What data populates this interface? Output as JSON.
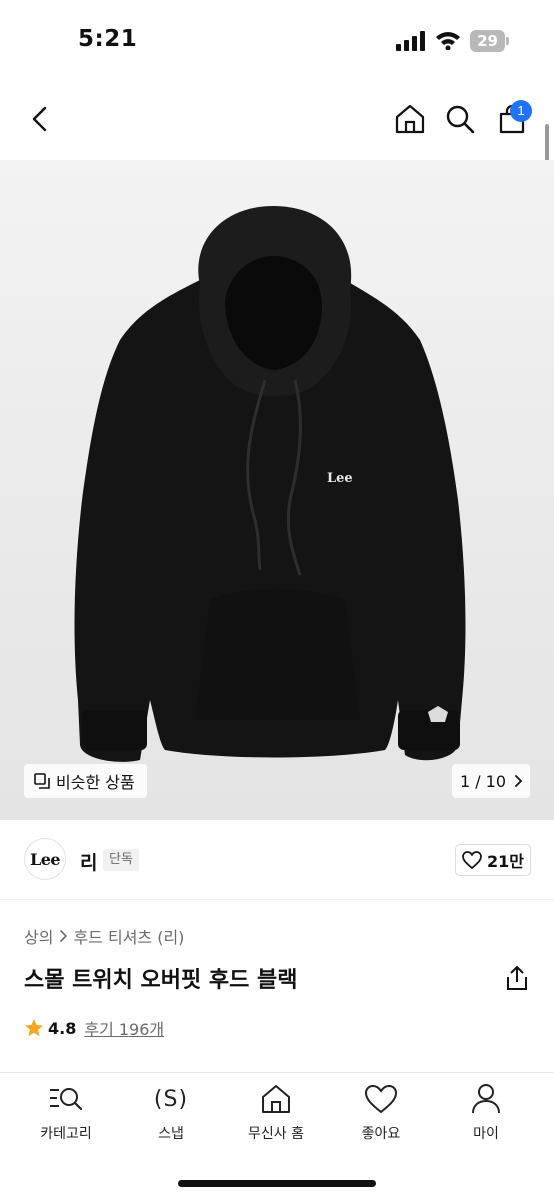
{
  "status_bar": {
    "time": "5:21",
    "battery": "29"
  },
  "header": {
    "cart_count": "1"
  },
  "gallery": {
    "similar_label": "비슷한 상품",
    "pager": "1 / 10",
    "image_brand_text": "Lee"
  },
  "brand": {
    "logo_text": "Lee",
    "name": "리",
    "badge": "단독",
    "likes": "21만"
  },
  "breadcrumb": [
    "상의",
    "후드 티셔츠 (리)"
  ],
  "product": {
    "title": "스몰 트위치 오버핏 후드 블랙",
    "rating": "4.8",
    "reviews": "후기 196개"
  },
  "tabs": [
    {
      "label": "카테고리",
      "icon": "category-search-icon"
    },
    {
      "label": "스냅",
      "icon": "snap-icon",
      "icon_text": "(S)"
    },
    {
      "label": "무신사 홈",
      "icon": "home-icon"
    },
    {
      "label": "좋아요",
      "icon": "heart-icon"
    },
    {
      "label": "마이",
      "icon": "person-icon"
    }
  ],
  "colors": {
    "badge_blue": "#1e74ff",
    "star": "#f5a623",
    "text_gray": "#6b6b6b"
  }
}
